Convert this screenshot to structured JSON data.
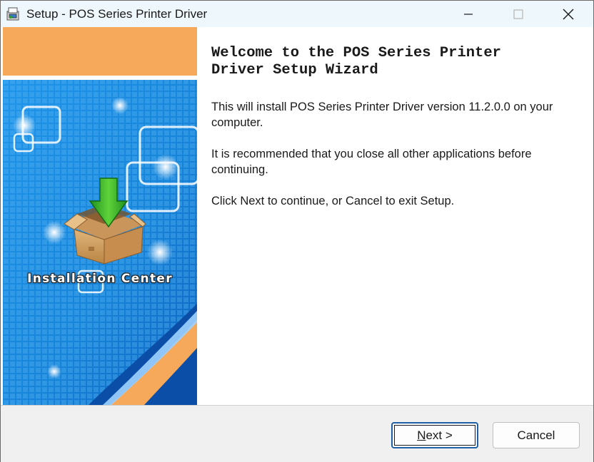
{
  "window": {
    "title": "Setup - POS Series Printer Driver",
    "controls": [
      "minimize-icon",
      "maximize-icon",
      "close-icon"
    ]
  },
  "banner": {
    "caption": "Installation Center",
    "colors": {
      "orange": "#f6a95a",
      "blue": "#1b8ce0",
      "dark_blue": "#0b5db8"
    }
  },
  "content": {
    "heading_line1": "Welcome to the POS Series Printer",
    "heading_line2": "Driver Setup Wizard",
    "paragraph1": "This will install POS Series Printer Driver version 11.2.0.0 on your computer.",
    "paragraph2": "It is recommended that you close all other applications before continuing.",
    "paragraph3": "Click Next to continue, or Cancel to exit Setup."
  },
  "footer": {
    "next_accel": "N",
    "next_rest": "ext >",
    "cancel_label": "Cancel",
    "default_button_border": "#1f5fa8"
  }
}
